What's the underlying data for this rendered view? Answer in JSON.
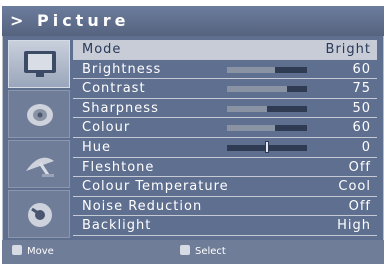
{
  "title": "> Picture",
  "sidebar": [
    {
      "icon": "tv-screen-icon",
      "active": true
    },
    {
      "icon": "speaker-icon",
      "active": false
    },
    {
      "icon": "satellite-dish-icon",
      "active": false
    },
    {
      "icon": "settings-disc-icon",
      "active": false
    }
  ],
  "menu": [
    {
      "label": "Mode",
      "value": "Bright"
    },
    {
      "label": "Brightness",
      "value": "60",
      "level": 0.6
    },
    {
      "label": "Contrast",
      "value": "75",
      "level": 0.75
    },
    {
      "label": "Sharpness",
      "value": "50",
      "level": 0.5
    },
    {
      "label": "Colour",
      "value": "60",
      "level": 0.6
    },
    {
      "label": "Hue",
      "value": "0",
      "level": 0.5
    },
    {
      "label": "Fleshtone",
      "value": "Off"
    },
    {
      "label": "Colour Temperature",
      "value": "Cool"
    },
    {
      "label": "Noise Reduction",
      "value": "Off"
    },
    {
      "label": "Backlight",
      "value": "High"
    }
  ],
  "footer": {
    "move_label": "Move",
    "select_label": "Select"
  },
  "colors": {
    "panel": "#5f6f90",
    "selected_row": "#c7ccd6",
    "bar_track": "#2f3b52",
    "bar_fill": "#8a93a4"
  }
}
